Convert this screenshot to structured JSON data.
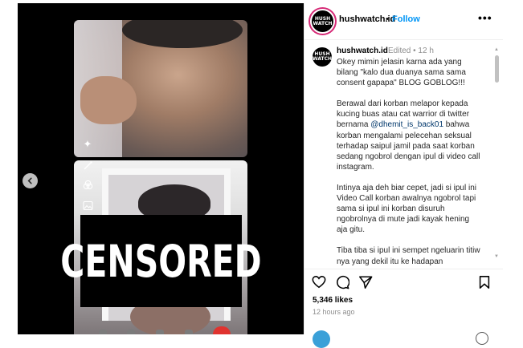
{
  "media": {
    "censor_text": "CENSORED",
    "prev_button": "chevron-left-icon"
  },
  "header": {
    "avatar_text": "HUSH WATCH",
    "username": "hushwatch.id",
    "separator": "•",
    "follow_label": "Follow",
    "more_label": "•••"
  },
  "caption": {
    "username": "hushwatch.id",
    "meta": "Edited • 12 h",
    "avatar_text": "HUSH WATCH",
    "paragraphs": [
      "Okey mimin jelasin karna ada yang bilang \"kalo dua duanya sama sama consent gapapa\" BLOG GOBLOG!!!",
      "Berawal dari korban melapor kepada kucing buas atau cat warrior di twitter bernama ",
      "@dhemit_is_back01",
      " bahwa korban mengalami pelecehan seksual terhadap saipul jamil pada saat korban sedang ngobrol dengan ipul di video call instagram.",
      "Intinya aja deh biar cepet, jadi si ipul ini Video Call korban awalnya ngobrol tapi sama si ipul ini korban disuruh ngobrolnya di mute jadi kayak hening aja gitu.",
      "Tiba tiba si ipul ini sempet ngeluarin titiw nya yang dekil itu ke hadapan"
    ]
  },
  "actions": {
    "like_icon": "heart-icon",
    "comment_icon": "comment-icon",
    "share_icon": "share-icon",
    "save_icon": "bookmark-icon",
    "likes": "5,346 likes",
    "time": "12 hours ago"
  },
  "colors": {
    "accent": "#0095f6",
    "mention": "#00376b",
    "muted": "#8e8e8e"
  }
}
